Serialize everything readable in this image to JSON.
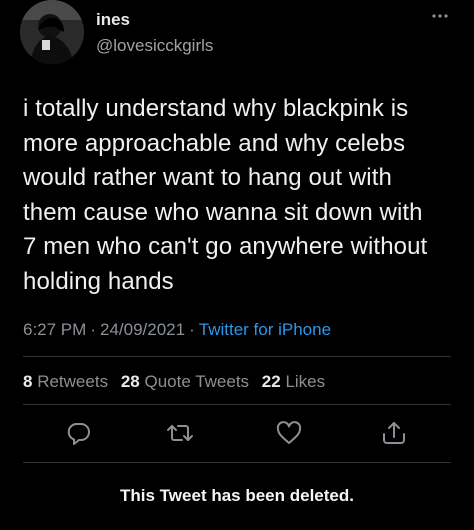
{
  "user": {
    "display_name": "ines",
    "handle": "@lovesicckgirls"
  },
  "tweet": {
    "lines": [
      "i totally understand why blackpink is",
      "more approachable and why celebs",
      "would rather want to hang out with",
      "them cause who wanna sit down with",
      "7 men who can't go anywhere without",
      "holding hands"
    ],
    "time": "6:27 PM",
    "date": "24/09/2021",
    "separator": "·",
    "source": "Twitter for iPhone"
  },
  "stats": {
    "retweets_count": "8",
    "retweets_label": "Retweets",
    "quotes_count": "28",
    "quotes_label": "Quote Tweets",
    "likes_count": "22",
    "likes_label": "Likes"
  },
  "actions": {
    "reply_icon": "reply-icon",
    "retweet_icon": "retweet-icon",
    "like_icon": "like-icon",
    "share_icon": "share-icon"
  },
  "footer": {
    "deleted_notice": "This Tweet has been deleted."
  },
  "colors": {
    "background": "#000000",
    "text": "#e7e9ea",
    "muted": "#8b9096",
    "link": "#2d97e6",
    "divider": "#2f3336"
  }
}
